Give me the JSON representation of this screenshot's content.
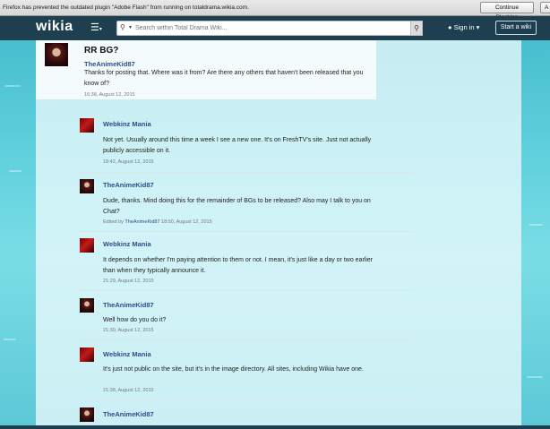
{
  "browser_bar": {
    "message": "Firefox has prevented the outdated plugin \"Adobe Flash\" from running on totaldrama.wikia.com.",
    "continue_label": "Continue Blocking",
    "more_label": "A"
  },
  "header": {
    "logo": "wikia",
    "search_placeholder": "Search within Total Drama Wiki...",
    "sign_in": "Sign in",
    "start_wiki": "Start a wiki"
  },
  "thread": {
    "title": "RR BG?",
    "author": "TheAnimeKid87",
    "text": "Thanks for posting that. Where was it from? Are there any others that haven't been released that you know of?",
    "timestamp": "16:38, August 12, 2015"
  },
  "replies": [
    {
      "author": "Webkinz Mania",
      "text": "Not yet. Usually around this time a week I see a new one. It's on FreshTV's site. Just not actually publicly accessible on it.",
      "timestamp": "18:42, August 12, 2015"
    },
    {
      "author": "TheAnimeKid87",
      "text": "Dude, thanks. Mind doing this for the remainder of BGs to be released? Also may I talk to you on Chat?",
      "edited_prefix": "Edited by",
      "edited_by": "TheAnimeKid87",
      "timestamp": "18:50, August 12, 2015"
    },
    {
      "author": "Webkinz Mania",
      "text": "It depends on whether I'm paying attention to them or not. I mean, it's just like a day or two earlier than when they typically announce it.",
      "timestamp": "21:29, August 12, 2015"
    },
    {
      "author": "TheAnimeKid87",
      "text": "Well how do you do it?",
      "timestamp": "21:30, August 12, 2015"
    },
    {
      "author": "Webkinz Mania",
      "text": "It's just not public on the site, but it's in the image directory. All sites, including Wikia have one.",
      "timestamp": "21:38, August 12, 2015"
    },
    {
      "author": "TheAnimeKid87"
    }
  ],
  "colors": {
    "header_bg": "#1e3f4f",
    "author_link": "#2c4b8c",
    "page_bg": "#5fd0dc"
  }
}
